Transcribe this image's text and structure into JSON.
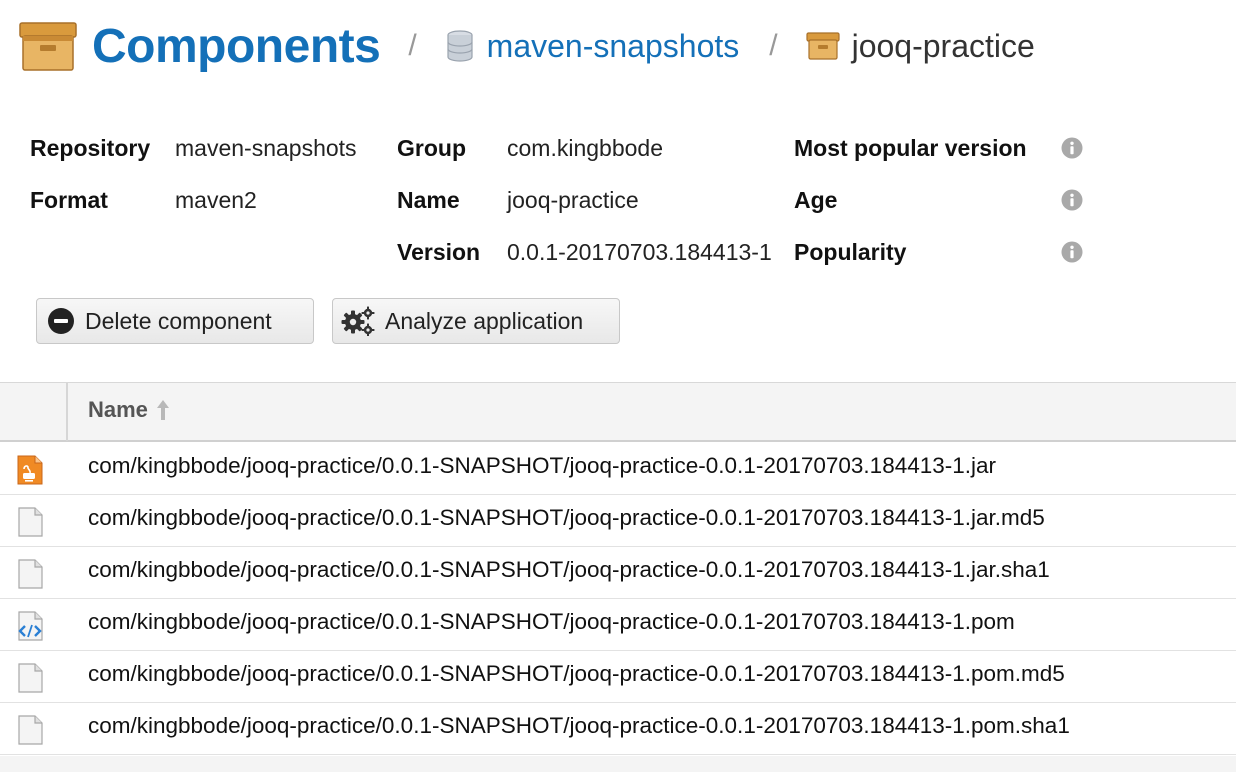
{
  "breadcrumb": {
    "title": "Components",
    "separator": "/",
    "repository": "maven-snapshots",
    "component": "jooq-practice"
  },
  "properties": {
    "repository_label": "Repository",
    "repository_value": "maven-snapshots",
    "format_label": "Format",
    "format_value": "maven2",
    "group_label": "Group",
    "group_value": "com.kingbbode",
    "name_label": "Name",
    "name_value": "jooq-practice",
    "version_label": "Version",
    "version_value": "0.0.1-20170703.184413-1",
    "most_popular_label": "Most popular version",
    "age_label": "Age",
    "popularity_label": "Popularity"
  },
  "buttons": {
    "delete_label": "Delete component",
    "analyze_label": "Analyze application"
  },
  "table": {
    "name_header": "Name",
    "rows": [
      {
        "name": "com/kingbbode/jooq-practice/0.0.1-SNAPSHOT/jooq-practice-0.0.1-20170703.184413-1.jar",
        "icon": "jar-file-icon"
      },
      {
        "name": "com/kingbbode/jooq-practice/0.0.1-SNAPSHOT/jooq-practice-0.0.1-20170703.184413-1.jar.md5",
        "icon": "file-icon"
      },
      {
        "name": "com/kingbbode/jooq-practice/0.0.1-SNAPSHOT/jooq-practice-0.0.1-20170703.184413-1.jar.sha1",
        "icon": "file-icon"
      },
      {
        "name": "com/kingbbode/jooq-practice/0.0.1-SNAPSHOT/jooq-practice-0.0.1-20170703.184413-1.pom",
        "icon": "xml-file-icon"
      },
      {
        "name": "com/kingbbode/jooq-practice/0.0.1-SNAPSHOT/jooq-practice-0.0.1-20170703.184413-1.pom.md5",
        "icon": "file-icon"
      },
      {
        "name": "com/kingbbode/jooq-practice/0.0.1-SNAPSHOT/jooq-practice-0.0.1-20170703.184413-1.pom.sha1",
        "icon": "file-icon"
      }
    ]
  },
  "colors": {
    "link_blue": "#1470b8",
    "box_tan": "#e0a850",
    "jar_orange": "#f08a24"
  }
}
